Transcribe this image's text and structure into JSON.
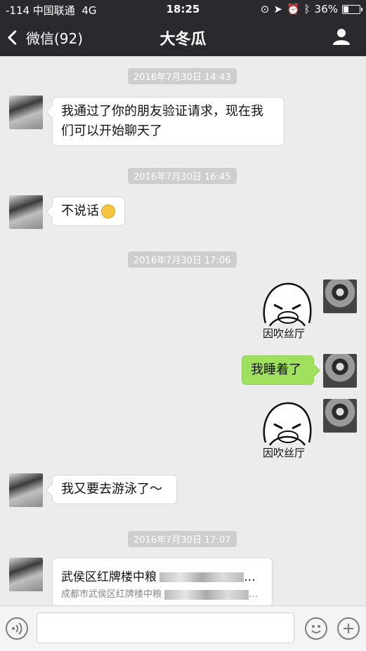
{
  "status": {
    "carrier": "-114 中国联通",
    "network": "4G",
    "time": "18:25",
    "battery": "36%",
    "battery_level": 0.36
  },
  "nav": {
    "back_label": "微信(92)",
    "title": "大冬瓜"
  },
  "messages": {
    "ts1": "2016年7月30日 14:43",
    "m1": "我通过了你的朋友验证请求，现在我们可以开始聊天了",
    "ts2": "2016年7月30日 16:45",
    "m2": "不说话",
    "ts3": "2016年7月30日 17:06",
    "sticker_caption": "因吹丝厅",
    "m3": "我睡着了",
    "m4": "我又要去游泳了～",
    "ts4": "2016年7月30日 17:07",
    "loc_title": "武侯区红牌楼中粮",
    "loc_addr": "成都市武侯区红牌楼中粮"
  },
  "colors": {
    "nav_bg": "#2a2a2e",
    "chat_bg": "#ececec",
    "my_bubble": "#9fe05f"
  },
  "icons": {
    "voice": "voice-icon",
    "emoji": "emoji-icon",
    "plus": "plus-icon",
    "person": "person-icon"
  }
}
